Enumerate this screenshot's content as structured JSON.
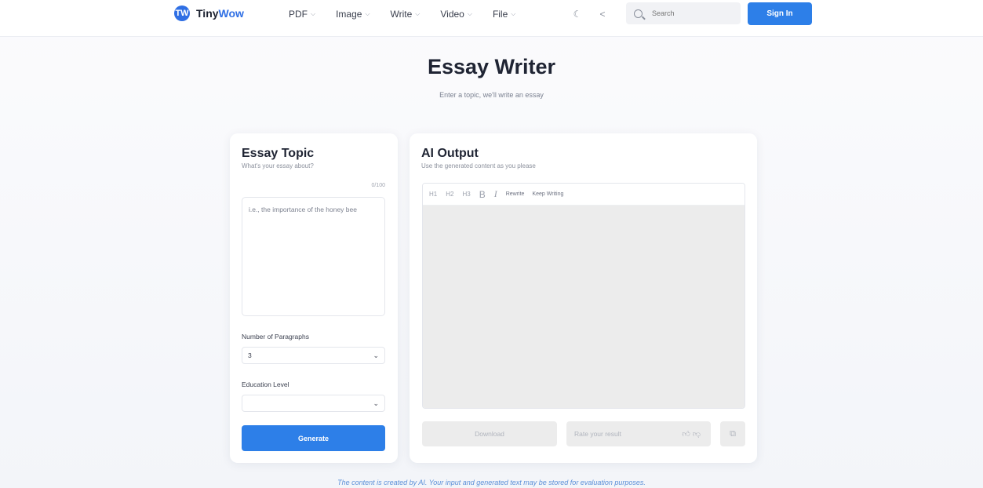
{
  "header": {
    "logo_mark": "TW",
    "logo_text_primary": "Tiny",
    "logo_text_accent": "Wow",
    "nav": [
      {
        "label": "PDF"
      },
      {
        "label": "Image"
      },
      {
        "label": "Write"
      },
      {
        "label": "Video"
      },
      {
        "label": "File"
      }
    ],
    "search_placeholder": "Search",
    "signin_label": "Sign In"
  },
  "hero": {
    "title": "Essay Writer",
    "subtitle": "Enter a topic, we'll write an essay"
  },
  "left_panel": {
    "title": "Essay Topic",
    "hint": "What's your essay about?",
    "counter": "0/100",
    "topic_placeholder": "i.e., the importance of the honey bee",
    "paragraphs_label": "Number of Paragraphs",
    "paragraphs_value": "3",
    "education_label": "Education Level",
    "education_value": "",
    "generate_label": "Generate"
  },
  "right_panel": {
    "title": "AI Output",
    "hint": "Use the generated content as you please",
    "toolbar": {
      "h1": "H1",
      "h2": "H2",
      "h3": "H3",
      "bold": "B",
      "italic": "I",
      "rewrite": "Rewrite",
      "keep_writing": "Keep Writing"
    },
    "download_label": "Download",
    "rate_label": "Rate your result"
  },
  "footer": {
    "disclaimer": "The content is created by AI. Your input and generated text may be stored for evaluation purposes."
  },
  "colors": {
    "accent": "#2d7fe8",
    "logo": "#2f6fe4",
    "disabled_bg": "#ececec"
  },
  "icons": [
    "moon-icon",
    "share-icon",
    "search-icon",
    "chevron-down-icon",
    "thumbs-up-icon",
    "thumbs-down-icon",
    "copy-icon"
  ]
}
